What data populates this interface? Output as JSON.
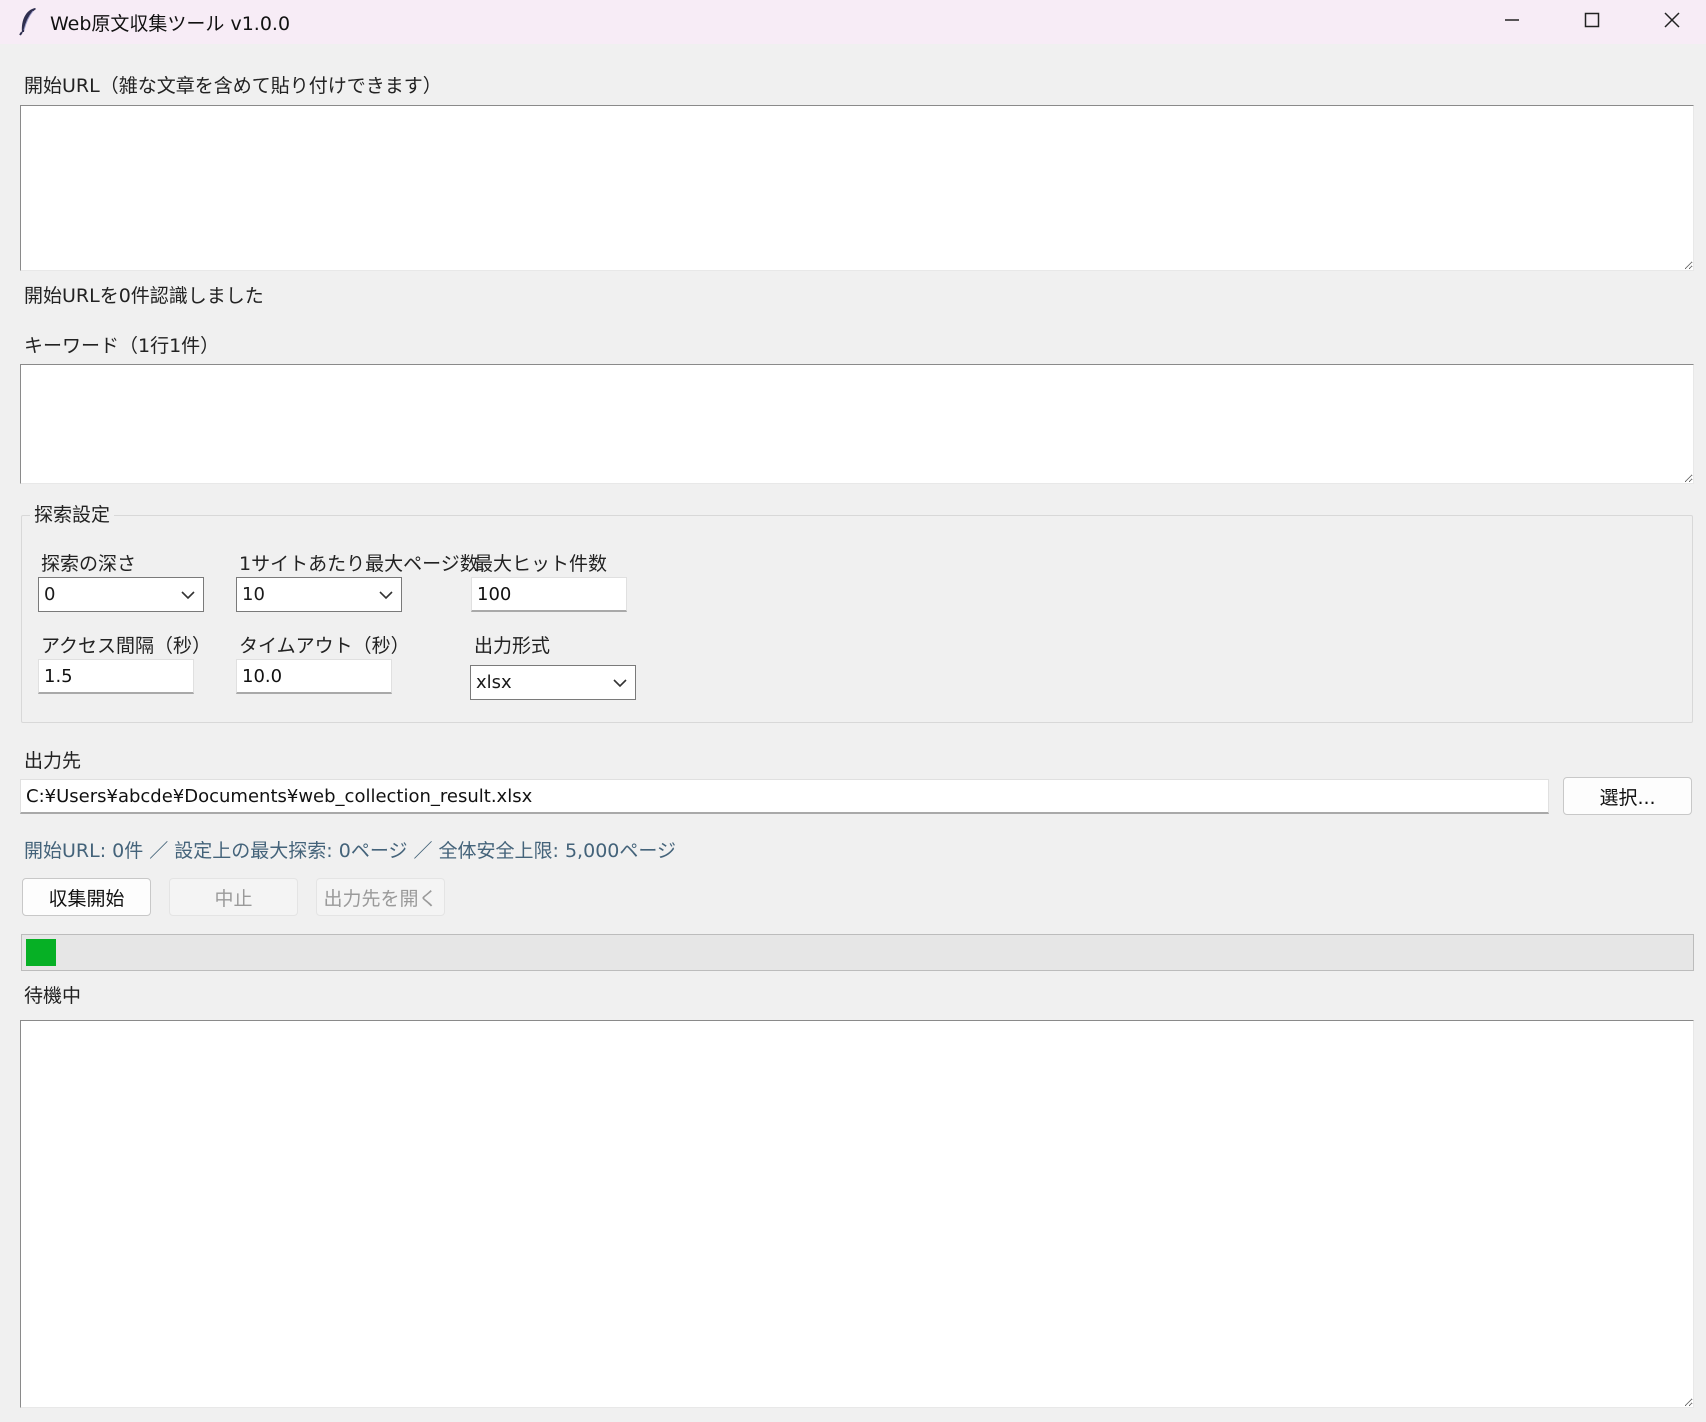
{
  "window": {
    "title": "Web原文収集ツール v1.0.0",
    "controls": [
      "minimize-icon",
      "maximize-icon",
      "close-icon"
    ]
  },
  "start_url": {
    "label": "開始URL（雑な文章を含めて貼り付けできます）",
    "value": "",
    "recognized_text": "開始URLを0件認識しました"
  },
  "keywords": {
    "label": "キーワード（1行1件）",
    "value": ""
  },
  "search_settings": {
    "title": "探索設定",
    "depth": {
      "label": "探索の深さ",
      "value": "0"
    },
    "max_pages": {
      "label": "1サイトあたり最大ページ数",
      "value": "10"
    },
    "max_hits": {
      "label": "最大ヒット件数",
      "value": "100"
    },
    "interval": {
      "label": "アクセス間隔（秒）",
      "value": "1.5"
    },
    "timeout": {
      "label": "タイムアウト（秒）",
      "value": "10.0"
    },
    "format": {
      "label": "出力形式",
      "value": "xlsx"
    }
  },
  "output": {
    "label": "出力先",
    "path": "C:¥Users¥abcde¥Documents¥web_collection_result.xlsx",
    "select_label": "選択..."
  },
  "summary_text": "開始URL: 0件 ／ 設定上の最大探索: 0ページ ／ 全体安全上限: 5,000ページ",
  "actions": {
    "start_label": "収集開始",
    "stop_label": "中止",
    "open_label": "出力先を開く"
  },
  "progress": {
    "fraction": 0.018
  },
  "status_text": "待機中",
  "log": {
    "value": ""
  },
  "colors": {
    "progress": "#06b025",
    "titlebar": "#f7ecf6",
    "info_text": "#44637a"
  }
}
